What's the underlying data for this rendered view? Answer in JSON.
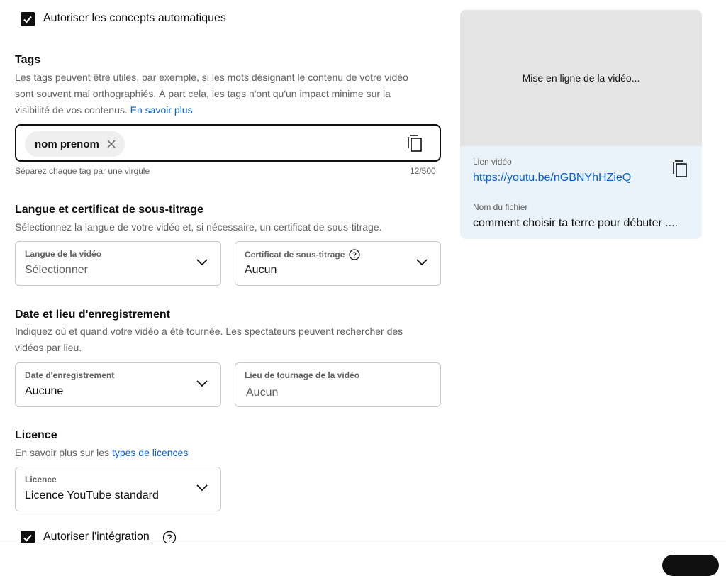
{
  "auto_concepts": {
    "label": "Autoriser les concepts automatiques",
    "checked": true
  },
  "tags": {
    "title": "Tags",
    "description": "Les tags peuvent être utiles, par exemple, si les mots désignant le contenu de votre vidéo sont souvent mal orthographiés. À part cela, les tags n'ont qu'un impact minime sur la visibilité de vos contenus.",
    "learn_more": "En savoir plus",
    "chips": [
      "nom prenom"
    ],
    "hint": "Séparez chaque tag par une virgule",
    "count": "12/500"
  },
  "language": {
    "title": "Langue et certificat de sous-titrage",
    "description": "Sélectionnez la langue de votre vidéo et, si nécessaire, un certificat de sous-titrage.",
    "video_language": {
      "label": "Langue de la vidéo",
      "value": "Sélectionner"
    },
    "caption_cert": {
      "label": "Certificat de sous-titrage",
      "value": "Aucun"
    }
  },
  "recording": {
    "title": "Date et lieu d'enregistrement",
    "description": "Indiquez où et quand votre vidéo a été tournée. Les spectateurs peuvent rechercher des vidéos par lieu.",
    "date": {
      "label": "Date d'enregistrement",
      "value": "Aucune"
    },
    "location": {
      "label": "Lieu de tournage de la vidéo",
      "placeholder": "Aucun"
    }
  },
  "license": {
    "title": "Licence",
    "description_prefix": "En savoir plus sur les",
    "link": "types de licences",
    "field": {
      "label": "Licence",
      "value": "Licence YouTube standard"
    }
  },
  "embedding": {
    "label": "Autoriser l'intégration",
    "checked": true
  },
  "preview": {
    "uploading": "Mise en ligne de la vidéo...",
    "link_label": "Lien vidéo",
    "link_url": "https://youtu.be/nGBNYhHZieQ",
    "filename_label": "Nom du fichier",
    "filename": "comment choisir ta terre pour débuter ...."
  },
  "colors": {
    "accent": "#065fd4",
    "text": "#0f0f0f",
    "secondary": "#606060",
    "panel": "#eaf3fa"
  }
}
